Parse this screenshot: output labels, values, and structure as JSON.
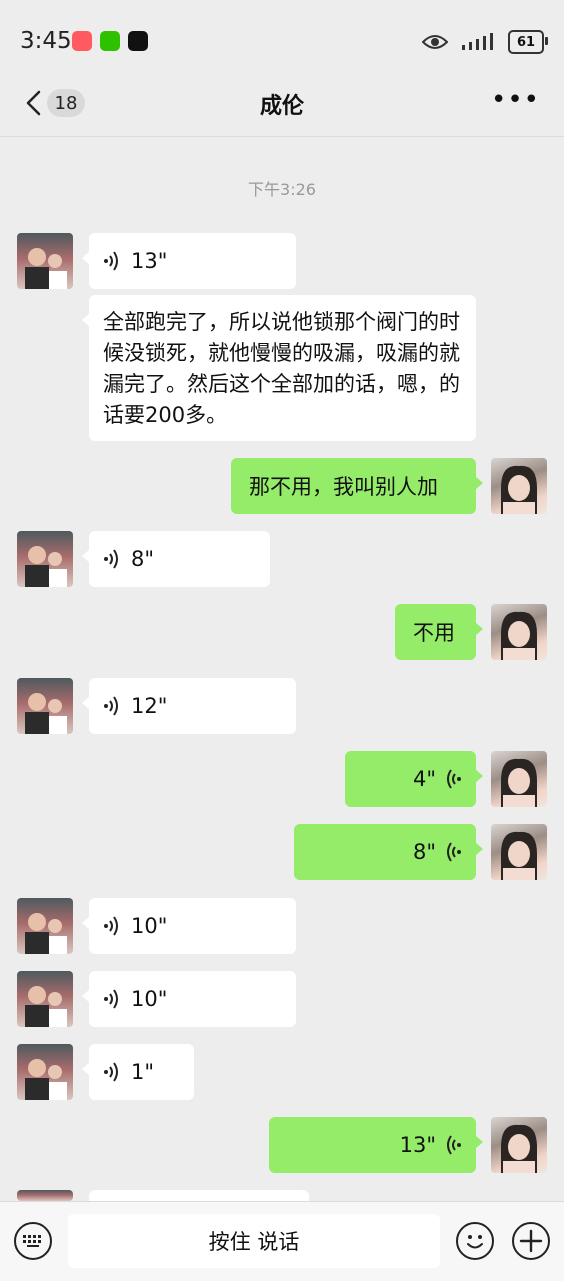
{
  "status_bar": {
    "time": "3:45",
    "battery": "61",
    "icons": [
      "app-badge-icon",
      "wechat-icon",
      "tiktok-icon",
      "eye-icon",
      "signal-icon",
      "battery-icon"
    ]
  },
  "header": {
    "unread_count": "18",
    "title": "成伦",
    "more_label": "•••"
  },
  "timestamp": "下午3:26",
  "messages": [
    {
      "side": "left",
      "type": "voice",
      "duration": "13\""
    },
    {
      "side": "left",
      "type": "text",
      "text": "全部跑完了，所以说他锁那个阀门的时候没锁死，就他慢慢的吸漏，吸漏的就漏完了。然后这个全部加的话，嗯，的话要200多。"
    },
    {
      "side": "right",
      "type": "text",
      "text": "那不用，我叫别人加"
    },
    {
      "side": "left",
      "type": "voice",
      "duration": "8\""
    },
    {
      "side": "right",
      "type": "text",
      "text": "不用"
    },
    {
      "side": "left",
      "type": "voice",
      "duration": "12\""
    },
    {
      "side": "right",
      "type": "voice",
      "duration": "4\""
    },
    {
      "side": "right",
      "type": "voice",
      "duration": "8\""
    },
    {
      "side": "left",
      "type": "voice",
      "duration": "10\""
    },
    {
      "side": "left",
      "type": "voice",
      "duration": "10\""
    },
    {
      "side": "left",
      "type": "voice",
      "duration": "1\""
    },
    {
      "side": "right",
      "type": "voice",
      "duration": "13\""
    }
  ],
  "input_bar": {
    "hold_to_talk": "按住 说话"
  },
  "colors": {
    "background": "#ededed",
    "sent_bubble": "#95ec69",
    "received_bubble": "#ffffff"
  }
}
